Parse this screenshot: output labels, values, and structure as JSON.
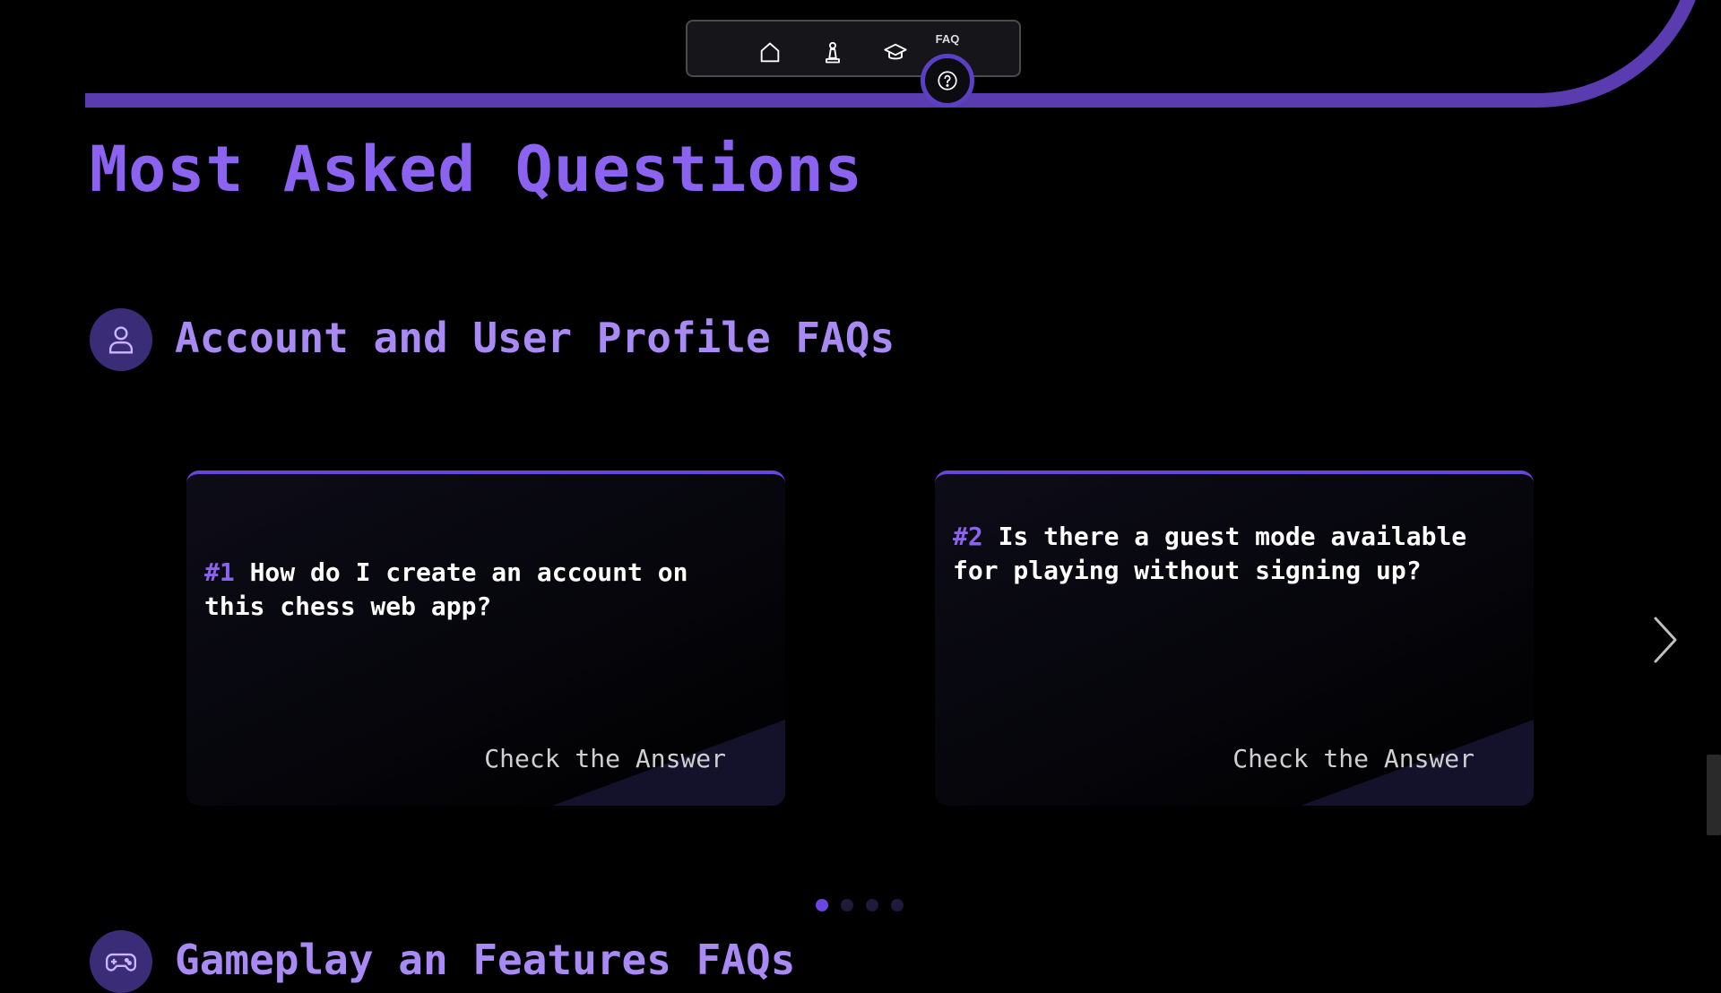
{
  "nav": {
    "items": [
      {
        "icon": "home-icon",
        "label": ""
      },
      {
        "icon": "chess-pawn-icon",
        "label": ""
      },
      {
        "icon": "graduation-cap-icon",
        "label": ""
      },
      {
        "icon": "question-circle-icon",
        "label": "FAQ",
        "active": true
      }
    ],
    "faq_label": "FAQ"
  },
  "page": {
    "title": "Most Asked Questions"
  },
  "sections": [
    {
      "icon": "user-icon",
      "title": "Account and User Profile FAQs",
      "cards": [
        {
          "number": "#1",
          "question": "How do I create an account on this chess web app?",
          "link": "Check the Answer"
        },
        {
          "number": "#2",
          "question": "Is there a guest mode available for playing without signing up?",
          "link": "Check the Answer"
        }
      ],
      "carousel": {
        "pages": 4,
        "current": 1
      }
    },
    {
      "icon": "gamepad-icon",
      "title": "Gameplay an Features FAQs"
    }
  ],
  "colors": {
    "accent": "#8b63f0",
    "accent_dark": "#5b3fc4",
    "background": "#000000"
  }
}
